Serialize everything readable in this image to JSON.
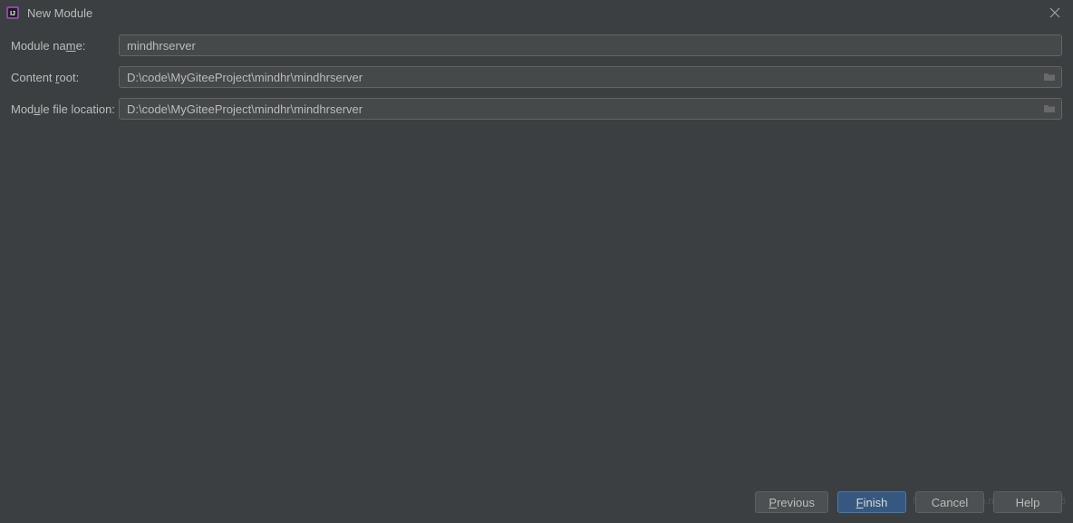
{
  "titlebar": {
    "title": "New Module"
  },
  "form": {
    "moduleName": {
      "labelPrefix": "Module na",
      "labelUnderline": "m",
      "labelSuffix": "e:",
      "value": "mindhrserver"
    },
    "contentRoot": {
      "labelPrefix": "Content ",
      "labelUnderline": "r",
      "labelSuffix": "oot:",
      "value": "D:\\code\\MyGiteeProject\\mindhr\\mindhrserver"
    },
    "moduleFileLocation": {
      "labelPrefix": "Mod",
      "labelUnderline": "u",
      "labelSuffix": "le file location:",
      "value": "D:\\code\\MyGiteeProject\\mindhr\\mindhrserver"
    }
  },
  "buttons": {
    "previous": {
      "underline": "P",
      "rest": "revious"
    },
    "finish": {
      "underline": "F",
      "rest": "inish"
    },
    "cancel": {
      "label": "Cancel"
    },
    "help": {
      "label": "Help"
    }
  },
  "watermark": "https://blog.csdn.net/qq_42700766"
}
